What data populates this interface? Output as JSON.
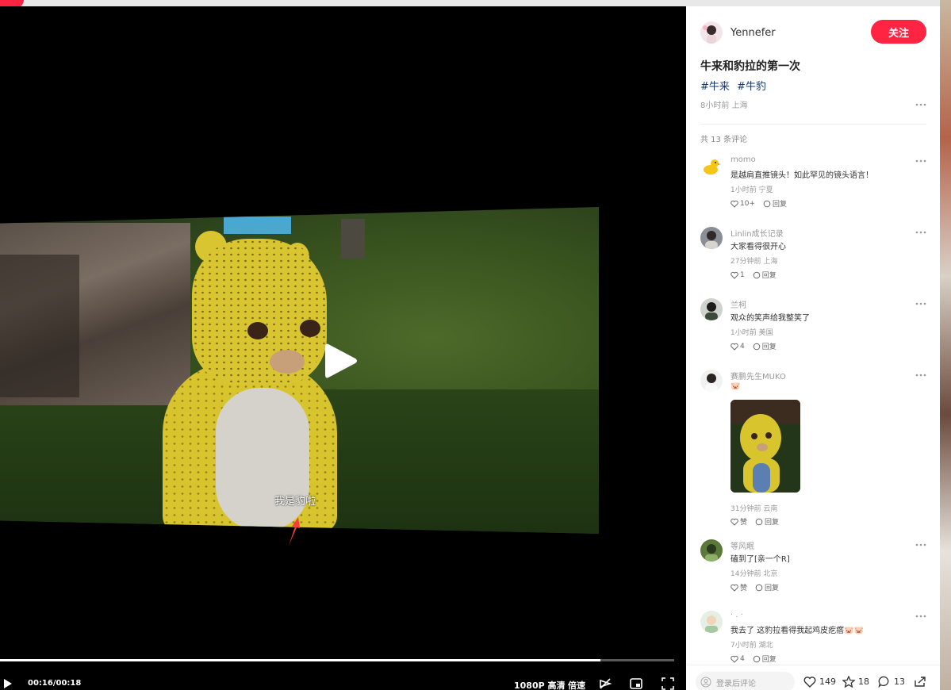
{
  "video": {
    "subtitle": "我是豹啦",
    "time": "00:16/00:18",
    "progress": 0.89,
    "quality": "1080P 高清",
    "speed": "倍速"
  },
  "post": {
    "author": "Yennefer",
    "follow_label": "关注",
    "title": "牛来和豹拉的第一次",
    "tags": [
      "#牛来",
      "#牛豹"
    ],
    "meta": "8小时前 上海",
    "comment_count": "共 13 条评论"
  },
  "comments": [
    {
      "name": "momo",
      "text": "是越肩直推镜头！如此罕见的镜头语言！",
      "meta": "1小时前 宁夏",
      "likes": "10+",
      "reply": "回复"
    },
    {
      "name": "Linlin成长记录",
      "text": "大家看得很开心",
      "meta": "27分钟前 上海",
      "likes": "1",
      "reply": "回复"
    },
    {
      "name": "兰柯",
      "text": "观众的笑声给我整笑了",
      "meta": "1小时前 美国",
      "likes": "4",
      "reply": "回复"
    },
    {
      "name": "赛鹏先生MUKO",
      "text": "🐷",
      "meta": "31分钟前 云南",
      "likes": "赞",
      "reply": "回复"
    },
    {
      "name": "等风眠",
      "text": "磕到了[亲一个R]",
      "meta": "14分钟前 北京",
      "likes": "赞",
      "reply": "回复"
    },
    {
      "name": "· . ·",
      "text": "我去了 这豹拉看得我起鸡皮疙瘩🐷🐷",
      "meta": "7小时前 湖北",
      "likes": "4",
      "reply": "回复"
    }
  ],
  "footer": {
    "login_placeholder": "登录后评论",
    "likes": "149",
    "stars": "18",
    "comments": "13"
  },
  "colors": {
    "accent": "#ff2442",
    "tag": "#13386c"
  }
}
